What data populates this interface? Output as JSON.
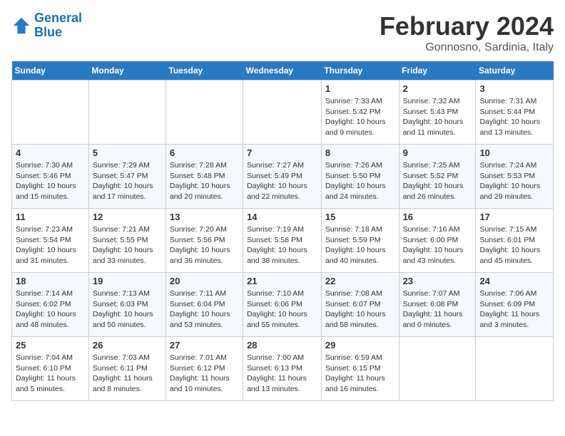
{
  "header": {
    "logo_line1": "General",
    "logo_line2": "Blue",
    "month": "February 2024",
    "location": "Gonnosno, Sardinia, Italy"
  },
  "weekdays": [
    "Sunday",
    "Monday",
    "Tuesday",
    "Wednesday",
    "Thursday",
    "Friday",
    "Saturday"
  ],
  "weeks": [
    [
      {
        "day": "",
        "info": ""
      },
      {
        "day": "",
        "info": ""
      },
      {
        "day": "",
        "info": ""
      },
      {
        "day": "",
        "info": ""
      },
      {
        "day": "1",
        "info": "Sunrise: 7:33 AM\nSunset: 5:42 PM\nDaylight: 10 hours and 9 minutes."
      },
      {
        "day": "2",
        "info": "Sunrise: 7:32 AM\nSunset: 5:43 PM\nDaylight: 10 hours and 11 minutes."
      },
      {
        "day": "3",
        "info": "Sunrise: 7:31 AM\nSunset: 5:44 PM\nDaylight: 10 hours and 13 minutes."
      }
    ],
    [
      {
        "day": "4",
        "info": "Sunrise: 7:30 AM\nSunset: 5:46 PM\nDaylight: 10 hours and 15 minutes."
      },
      {
        "day": "5",
        "info": "Sunrise: 7:29 AM\nSunset: 5:47 PM\nDaylight: 10 hours and 17 minutes."
      },
      {
        "day": "6",
        "info": "Sunrise: 7:28 AM\nSunset: 5:48 PM\nDaylight: 10 hours and 20 minutes."
      },
      {
        "day": "7",
        "info": "Sunrise: 7:27 AM\nSunset: 5:49 PM\nDaylight: 10 hours and 22 minutes."
      },
      {
        "day": "8",
        "info": "Sunrise: 7:26 AM\nSunset: 5:50 PM\nDaylight: 10 hours and 24 minutes."
      },
      {
        "day": "9",
        "info": "Sunrise: 7:25 AM\nSunset: 5:52 PM\nDaylight: 10 hours and 26 minutes."
      },
      {
        "day": "10",
        "info": "Sunrise: 7:24 AM\nSunset: 5:53 PM\nDaylight: 10 hours and 29 minutes."
      }
    ],
    [
      {
        "day": "11",
        "info": "Sunrise: 7:23 AM\nSunset: 5:54 PM\nDaylight: 10 hours and 31 minutes."
      },
      {
        "day": "12",
        "info": "Sunrise: 7:21 AM\nSunset: 5:55 PM\nDaylight: 10 hours and 33 minutes."
      },
      {
        "day": "13",
        "info": "Sunrise: 7:20 AM\nSunset: 5:56 PM\nDaylight: 10 hours and 36 minutes."
      },
      {
        "day": "14",
        "info": "Sunrise: 7:19 AM\nSunset: 5:58 PM\nDaylight: 10 hours and 38 minutes."
      },
      {
        "day": "15",
        "info": "Sunrise: 7:18 AM\nSunset: 5:59 PM\nDaylight: 10 hours and 40 minutes."
      },
      {
        "day": "16",
        "info": "Sunrise: 7:16 AM\nSunset: 6:00 PM\nDaylight: 10 hours and 43 minutes."
      },
      {
        "day": "17",
        "info": "Sunrise: 7:15 AM\nSunset: 6:01 PM\nDaylight: 10 hours and 45 minutes."
      }
    ],
    [
      {
        "day": "18",
        "info": "Sunrise: 7:14 AM\nSunset: 6:02 PM\nDaylight: 10 hours and 48 minutes."
      },
      {
        "day": "19",
        "info": "Sunrise: 7:13 AM\nSunset: 6:03 PM\nDaylight: 10 hours and 50 minutes."
      },
      {
        "day": "20",
        "info": "Sunrise: 7:11 AM\nSunset: 6:04 PM\nDaylight: 10 hours and 53 minutes."
      },
      {
        "day": "21",
        "info": "Sunrise: 7:10 AM\nSunset: 6:06 PM\nDaylight: 10 hours and 55 minutes."
      },
      {
        "day": "22",
        "info": "Sunrise: 7:08 AM\nSunset: 6:07 PM\nDaylight: 10 hours and 58 minutes."
      },
      {
        "day": "23",
        "info": "Sunrise: 7:07 AM\nSunset: 6:08 PM\nDaylight: 11 hours and 0 minutes."
      },
      {
        "day": "24",
        "info": "Sunrise: 7:06 AM\nSunset: 6:09 PM\nDaylight: 11 hours and 3 minutes."
      }
    ],
    [
      {
        "day": "25",
        "info": "Sunrise: 7:04 AM\nSunset: 6:10 PM\nDaylight: 11 hours and 5 minutes."
      },
      {
        "day": "26",
        "info": "Sunrise: 7:03 AM\nSunset: 6:11 PM\nDaylight: 11 hours and 8 minutes."
      },
      {
        "day": "27",
        "info": "Sunrise: 7:01 AM\nSunset: 6:12 PM\nDaylight: 11 hours and 10 minutes."
      },
      {
        "day": "28",
        "info": "Sunrise: 7:00 AM\nSunset: 6:13 PM\nDaylight: 11 hours and 13 minutes."
      },
      {
        "day": "29",
        "info": "Sunrise: 6:59 AM\nSunset: 6:15 PM\nDaylight: 11 hours and 16 minutes."
      },
      {
        "day": "",
        "info": ""
      },
      {
        "day": "",
        "info": ""
      }
    ]
  ]
}
